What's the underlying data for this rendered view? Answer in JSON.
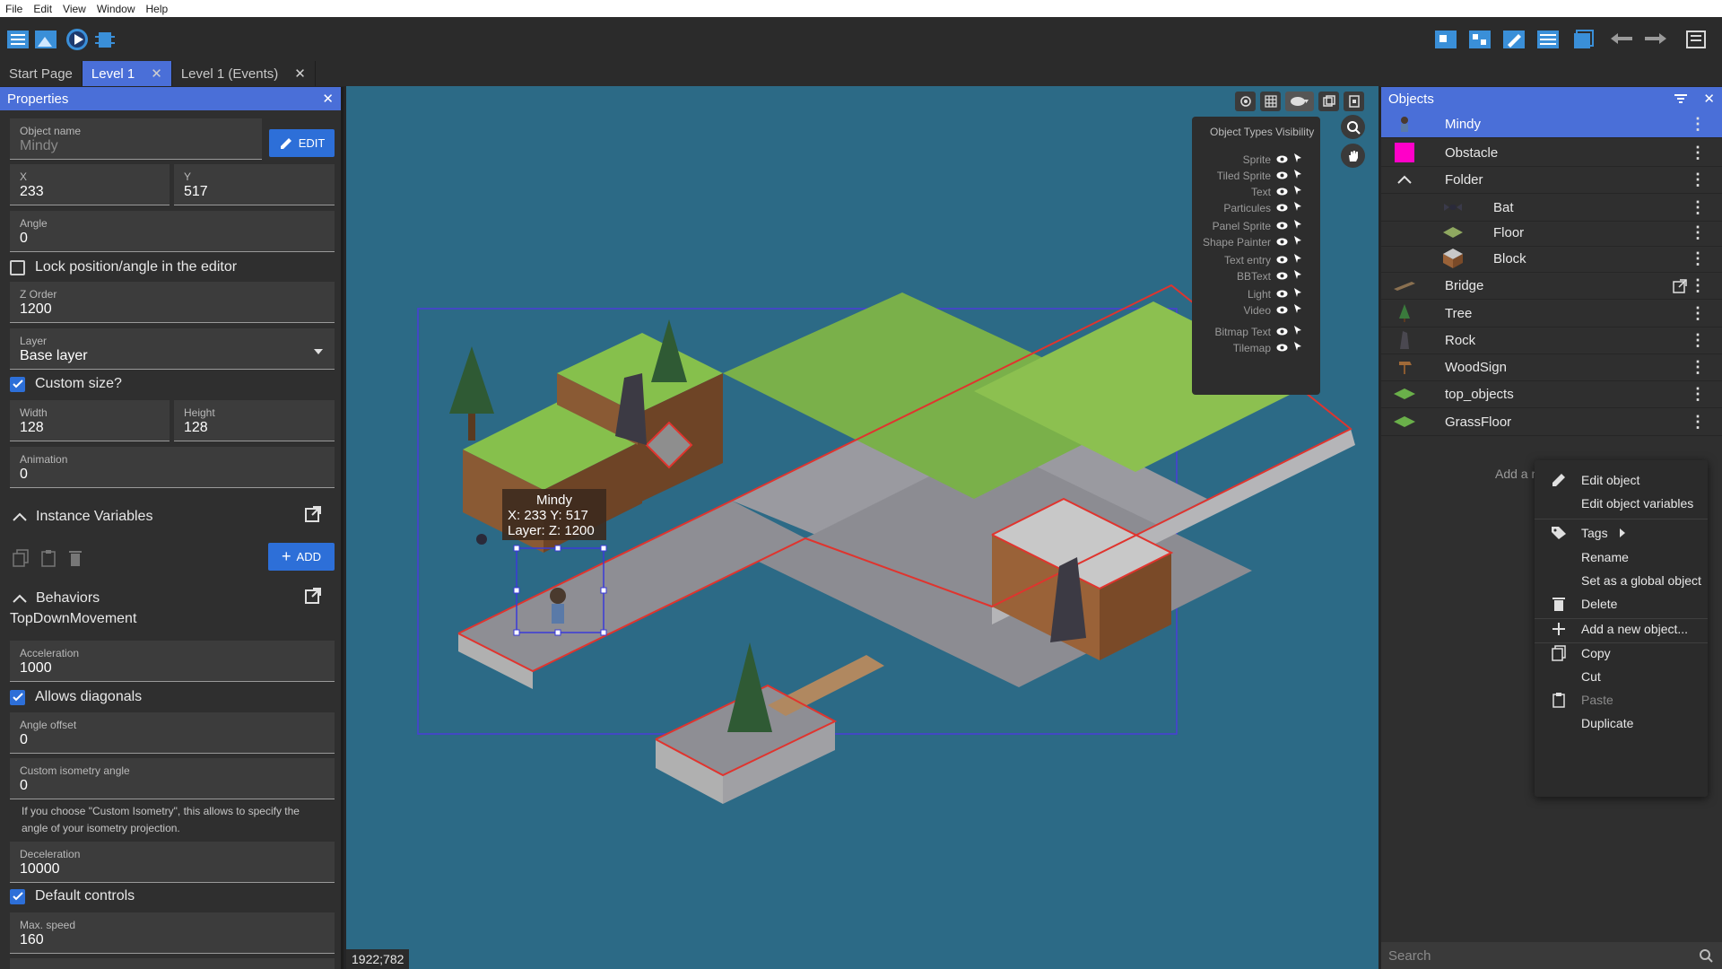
{
  "menubar": [
    "File",
    "Edit",
    "View",
    "Window",
    "Help"
  ],
  "tabs": [
    {
      "label": "Start Page",
      "closable": false
    },
    {
      "label": "Level 1",
      "closable": true
    },
    {
      "label": "Level 1 (Events)",
      "closable": true
    }
  ],
  "properties": {
    "title": "Properties",
    "object_name_label": "Object name",
    "object_name_value": "Mindy",
    "edit_button": "EDIT",
    "x_label": "X",
    "x_value": "233",
    "y_label": "Y",
    "y_value": "517",
    "angle_label": "Angle",
    "angle_value": "0",
    "lock_label": "Lock position/angle in the editor",
    "zorder_label": "Z Order",
    "zorder_value": "1200",
    "layer_label": "Layer",
    "layer_value": "Base layer",
    "custom_size_label": "Custom size?",
    "width_label": "Width",
    "width_value": "128",
    "height_label": "Height",
    "height_value": "128",
    "animation_label": "Animation",
    "animation_value": "0",
    "instance_variables": "Instance Variables",
    "add_button": "ADD",
    "behaviors": "Behaviors",
    "behavior_name": "TopDownMovement",
    "acceleration_label": "Acceleration",
    "acceleration_value": "1000",
    "allows_diagonals": "Allows diagonals",
    "angle_offset_label": "Angle offset",
    "angle_offset_value": "0",
    "custom_iso_label": "Custom isometry angle",
    "custom_iso_value": "0",
    "iso_hint": "If you choose \"Custom Isometry\", this allows to specify the angle of your isometry projection.",
    "deceleration_label": "Deceleration",
    "deceleration_value": "10000",
    "default_controls": "Default controls",
    "max_speed_label": "Max. speed",
    "max_speed_value": "160"
  },
  "scene": {
    "coords": "1922;782",
    "visibility_title": "Object Types Visibility",
    "visibility_items": [
      "Sprite",
      "Tiled Sprite",
      "Text",
      "Particules",
      "Panel Sprite",
      "Shape Painter",
      "Text entry",
      "BBText",
      "Light",
      "Video",
      "Bitmap Text",
      "Tilemap"
    ],
    "tooltip_name": "Mindy",
    "tooltip_pos": "X: 233  Y: 517",
    "tooltip_layer": "Layer:    Z: 1200",
    "colors": {
      "water": "#2c6a86",
      "selection": "#3a3ad8",
      "outline": "#e0342e"
    }
  },
  "objects": {
    "title": "Objects",
    "items": [
      {
        "label": "Mindy",
        "icon": "character-icon",
        "selected": true
      },
      {
        "label": "Obstacle",
        "icon": "magenta-square-icon"
      },
      {
        "label": "Folder",
        "icon": "chevron-up-icon"
      },
      {
        "label": "Bat",
        "icon": "bat-icon"
      },
      {
        "label": "Floor",
        "icon": "floor-tile-icon"
      },
      {
        "label": "Block",
        "icon": "block-icon"
      },
      {
        "label": "Bridge",
        "icon": "bridge-icon"
      },
      {
        "label": "Tree",
        "icon": "tree-icon"
      },
      {
        "label": "Rock",
        "icon": "rock-icon"
      },
      {
        "label": "WoodSign",
        "icon": "wood-sign-icon"
      },
      {
        "label": "top_objects",
        "icon": "grass-tile-icon"
      },
      {
        "label": "GrassFloor",
        "icon": "grass-tile-icon"
      }
    ],
    "add_text": "Add a r",
    "search_placeholder": "Search"
  },
  "context_menu": {
    "edit_object": "Edit object",
    "edit_variables": "Edit object variables",
    "tags": "Tags",
    "rename": "Rename",
    "set_global": "Set as a global object",
    "delete": "Delete",
    "add_new": "Add a new object...",
    "copy": "Copy",
    "cut": "Cut",
    "paste": "Paste",
    "duplicate": "Duplicate"
  }
}
